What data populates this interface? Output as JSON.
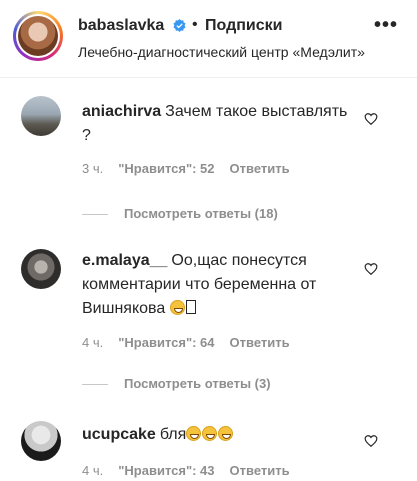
{
  "header": {
    "username": "babaslavka",
    "separator": "•",
    "follow_label": "Подписки",
    "location": "Лечебно-диагностический центр «Медэлит»",
    "more_label": "•••"
  },
  "comments": [
    {
      "username": "aniachirva",
      "text": "Зачем такое выставлять ?",
      "time": "3 ч.",
      "likes": "\"Нравится\": 52",
      "reply": "Ответить",
      "view_replies": "Посмотреть ответы (18)"
    },
    {
      "username": "e.malaya__",
      "text": "Оо,щас понесутся комментарии что беременна от Вишнякова",
      "time": "4 ч.",
      "likes": "\"Нравится\": 64",
      "reply": "Ответить",
      "view_replies": "Посмотреть ответы (3)"
    },
    {
      "username": "ucupcake",
      "text": "бля",
      "time": "4 ч.",
      "likes": "\"Нравится\": 43",
      "reply": "Ответить"
    }
  ],
  "colors": {
    "verified": "#3897f0",
    "muted": "#8e8e8e",
    "text": "#262626"
  }
}
